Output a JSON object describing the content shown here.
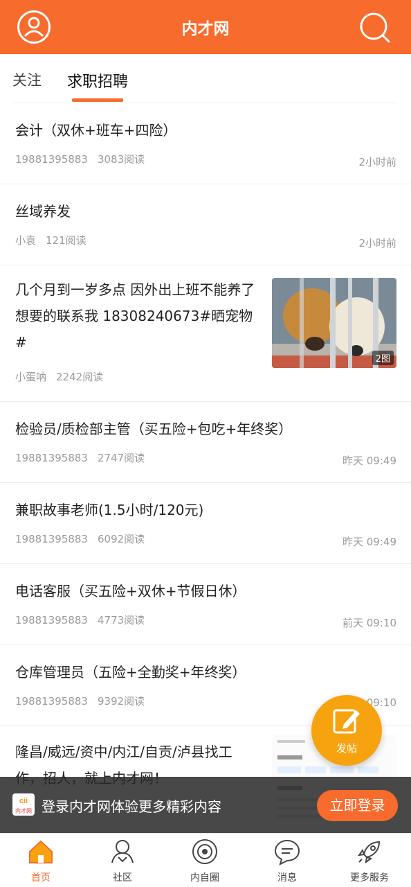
{
  "header": {
    "title": "内才网"
  },
  "tabs": [
    {
      "label": "关注"
    },
    {
      "label": "求职招聘"
    }
  ],
  "feed": [
    {
      "title": "会计（双休+班车+四险）",
      "author": "19881395883",
      "reads": "3083阅读",
      "time": "2小时前"
    },
    {
      "title": "丝域养发",
      "author": "小袁",
      "reads": "121阅读",
      "time": "2小时前"
    },
    {
      "title": "几个月到一岁多点 因外出上班不能养了 想要的联系我 18308240673#晒宠物#",
      "author": "小蛋呐",
      "reads": "2242阅读",
      "time": "",
      "image_count": "2图"
    },
    {
      "title": "检验员/质检部主管（买五险+包吃+年终奖）",
      "author": "19881395883",
      "reads": "2747阅读",
      "time": "昨天 09:49"
    },
    {
      "title": "兼职故事老师(1.5小时/120元)",
      "author": "19881395883",
      "reads": "6092阅读",
      "time": "昨天 09:49"
    },
    {
      "title": "电话客服（买五险+双休+节假日休）",
      "author": "19881395883",
      "reads": "4773阅读",
      "time": "前天 09:10"
    },
    {
      "title": "仓库管理员（五险+全勤奖+年终奖）",
      "author": "19881395883",
      "reads": "9392阅读",
      "time": "09:10"
    },
    {
      "title": "隆昌/威远/资中/内江/自贡/泸县找工作，招人，就上内才网！",
      "author": "",
      "reads": "",
      "time": ""
    }
  ],
  "post_button": {
    "label": "发帖"
  },
  "login_bar": {
    "logo_text": "内才网",
    "message": "登录内才网体验更多精彩内容",
    "button": "立即登录"
  },
  "bottom_nav": [
    {
      "label": "首页",
      "icon": "home-icon"
    },
    {
      "label": "社区",
      "icon": "community-icon"
    },
    {
      "label": "内自圈",
      "icon": "circle-icon"
    },
    {
      "label": "消息",
      "icon": "message-icon"
    },
    {
      "label": "更多服务",
      "icon": "rocket-icon"
    }
  ],
  "colors": {
    "brand": "#f76b2c",
    "post": "#f7a30f"
  }
}
